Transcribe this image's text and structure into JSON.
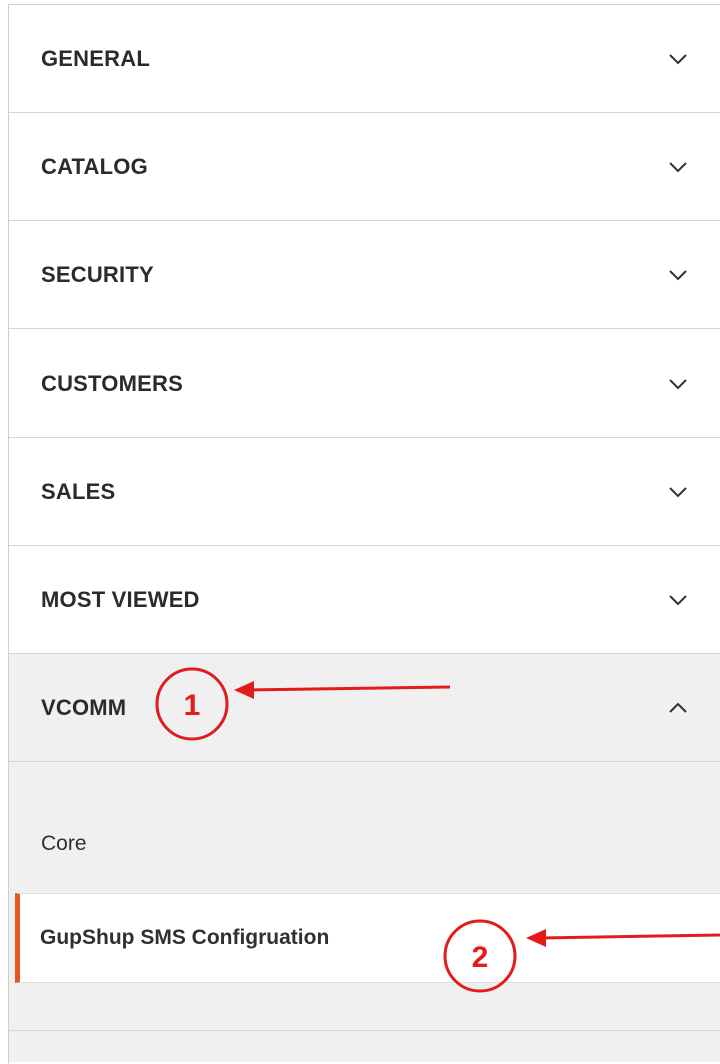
{
  "sections": [
    {
      "label": "GENERAL",
      "expanded": false
    },
    {
      "label": "CATALOG",
      "expanded": false
    },
    {
      "label": "SECURITY",
      "expanded": false
    },
    {
      "label": "CUSTOMERS",
      "expanded": false
    },
    {
      "label": "SALES",
      "expanded": false
    },
    {
      "label": "MOST VIEWED",
      "expanded": false
    },
    {
      "label": "VCOMM",
      "expanded": true
    }
  ],
  "vcomm_items": [
    {
      "label": "Core",
      "active": false
    },
    {
      "label": "GupShup SMS Configruation",
      "active": true
    }
  ],
  "annotations": [
    {
      "number": "1"
    },
    {
      "number": "2"
    }
  ],
  "colors": {
    "accent": "#e2561f",
    "annotation": "#e31b1b"
  }
}
